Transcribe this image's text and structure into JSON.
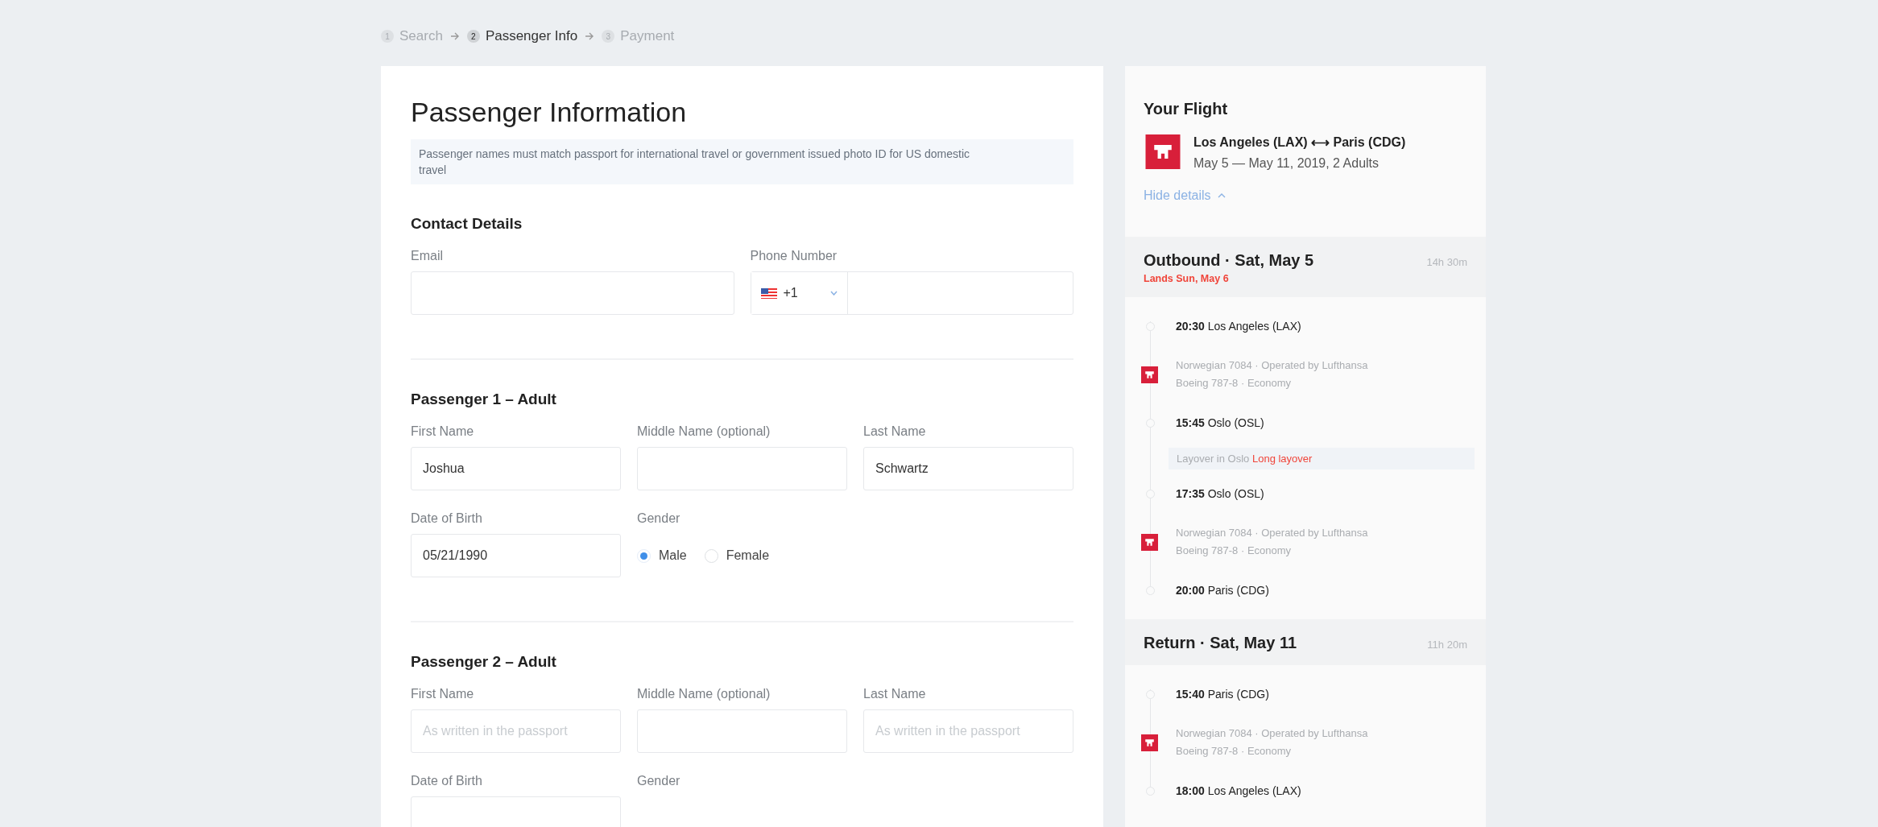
{
  "steps": [
    {
      "number": "1",
      "label": "Search",
      "selected": false
    },
    {
      "number": "2",
      "label": "Passenger Info",
      "selected": true
    },
    {
      "number": "3",
      "label": "Payment",
      "selected": false
    }
  ],
  "form": {
    "title": "Passenger Information",
    "notice": "Passenger names must match passport for international travel or government issued photo ID for US domestic travel",
    "sections": [
      {
        "kind": "contact",
        "title": "Contact Details",
        "rows": [
          [
            {
              "kind": "text",
              "label": "Email"
            },
            {
              "kind": "phone",
              "label": "Phone Number",
              "code": "+1"
            }
          ]
        ]
      },
      {
        "kind": "passenger",
        "title": "Passenger 1 – Adult",
        "rows": [
          [
            {
              "kind": "text",
              "label": "First Name",
              "value": "Joshua"
            },
            {
              "kind": "text",
              "label": "Middle Name (optional)"
            },
            {
              "kind": "text",
              "label": "Last Name",
              "value": "Schwartz"
            }
          ],
          [
            {
              "kind": "text",
              "label": "Date of Birth",
              "value": "05/21/1990"
            },
            {
              "kind": "radio",
              "label": "Gender",
              "options": [
                {
                  "label": "Male",
                  "selected": true
                },
                {
                  "label": "Female",
                  "selected": false
                }
              ]
            }
          ]
        ]
      },
      {
        "kind": "passenger",
        "title": "Passenger 2 – Adult",
        "rows": [
          [
            {
              "kind": "text",
              "label": "First Name",
              "placeholder": "As written in the passport"
            },
            {
              "kind": "text",
              "label": "Middle Name (optional)"
            },
            {
              "kind": "text",
              "label": "Last Name",
              "placeholder": "As written in the passport"
            }
          ],
          [
            {
              "kind": "text",
              "label": "Date of Birth"
            },
            {
              "kind": "radio",
              "label": "Gender"
            }
          ]
        ]
      }
    ]
  },
  "summary": {
    "title": "Your Flight",
    "route": "Los Angeles (LAX) ⟷ Paris (CDG)",
    "dates": "May 5 — May 11, 2019, 2 Adults",
    "toggle": "Hide details",
    "legs": [
      {
        "title": "Outbound · Sat, May 5",
        "duration": "14h 30m",
        "note": "Lands Sun, May 6",
        "items": [
          {
            "kind": "stop",
            "time": "20:30",
            "place": "Los Angeles (LAX)"
          },
          {
            "kind": "flight",
            "line1": "Norwegian 7084 · Operated by Lufthansa",
            "line2": "Boeing 787-8 · Economy"
          },
          {
            "kind": "stop",
            "time": "15:45",
            "place": "Oslo (OSL)"
          },
          {
            "kind": "layover",
            "text": "Layover in Oslo",
            "warning": "Long layover"
          },
          {
            "kind": "stop",
            "time": "17:35",
            "place": "Oslo (OSL)"
          },
          {
            "kind": "flight",
            "line1": "Norwegian 7084 · Operated by Lufthansa",
            "line2": "Boeing 787-8 · Economy"
          },
          {
            "kind": "stop",
            "time": "20:00",
            "place": "Paris (CDG)"
          }
        ]
      },
      {
        "title": "Return · Sat, May 11",
        "duration": "11h 20m",
        "items": [
          {
            "kind": "stop",
            "time": "15:40",
            "place": "Paris (CDG)"
          },
          {
            "kind": "flight",
            "line1": "Norwegian 7084 · Operated by Lufthansa",
            "line2": "Boeing 787-8 · Economy"
          },
          {
            "kind": "stop",
            "time": "18:00",
            "place": "Los Angeles (LAX)"
          }
        ]
      }
    ]
  }
}
